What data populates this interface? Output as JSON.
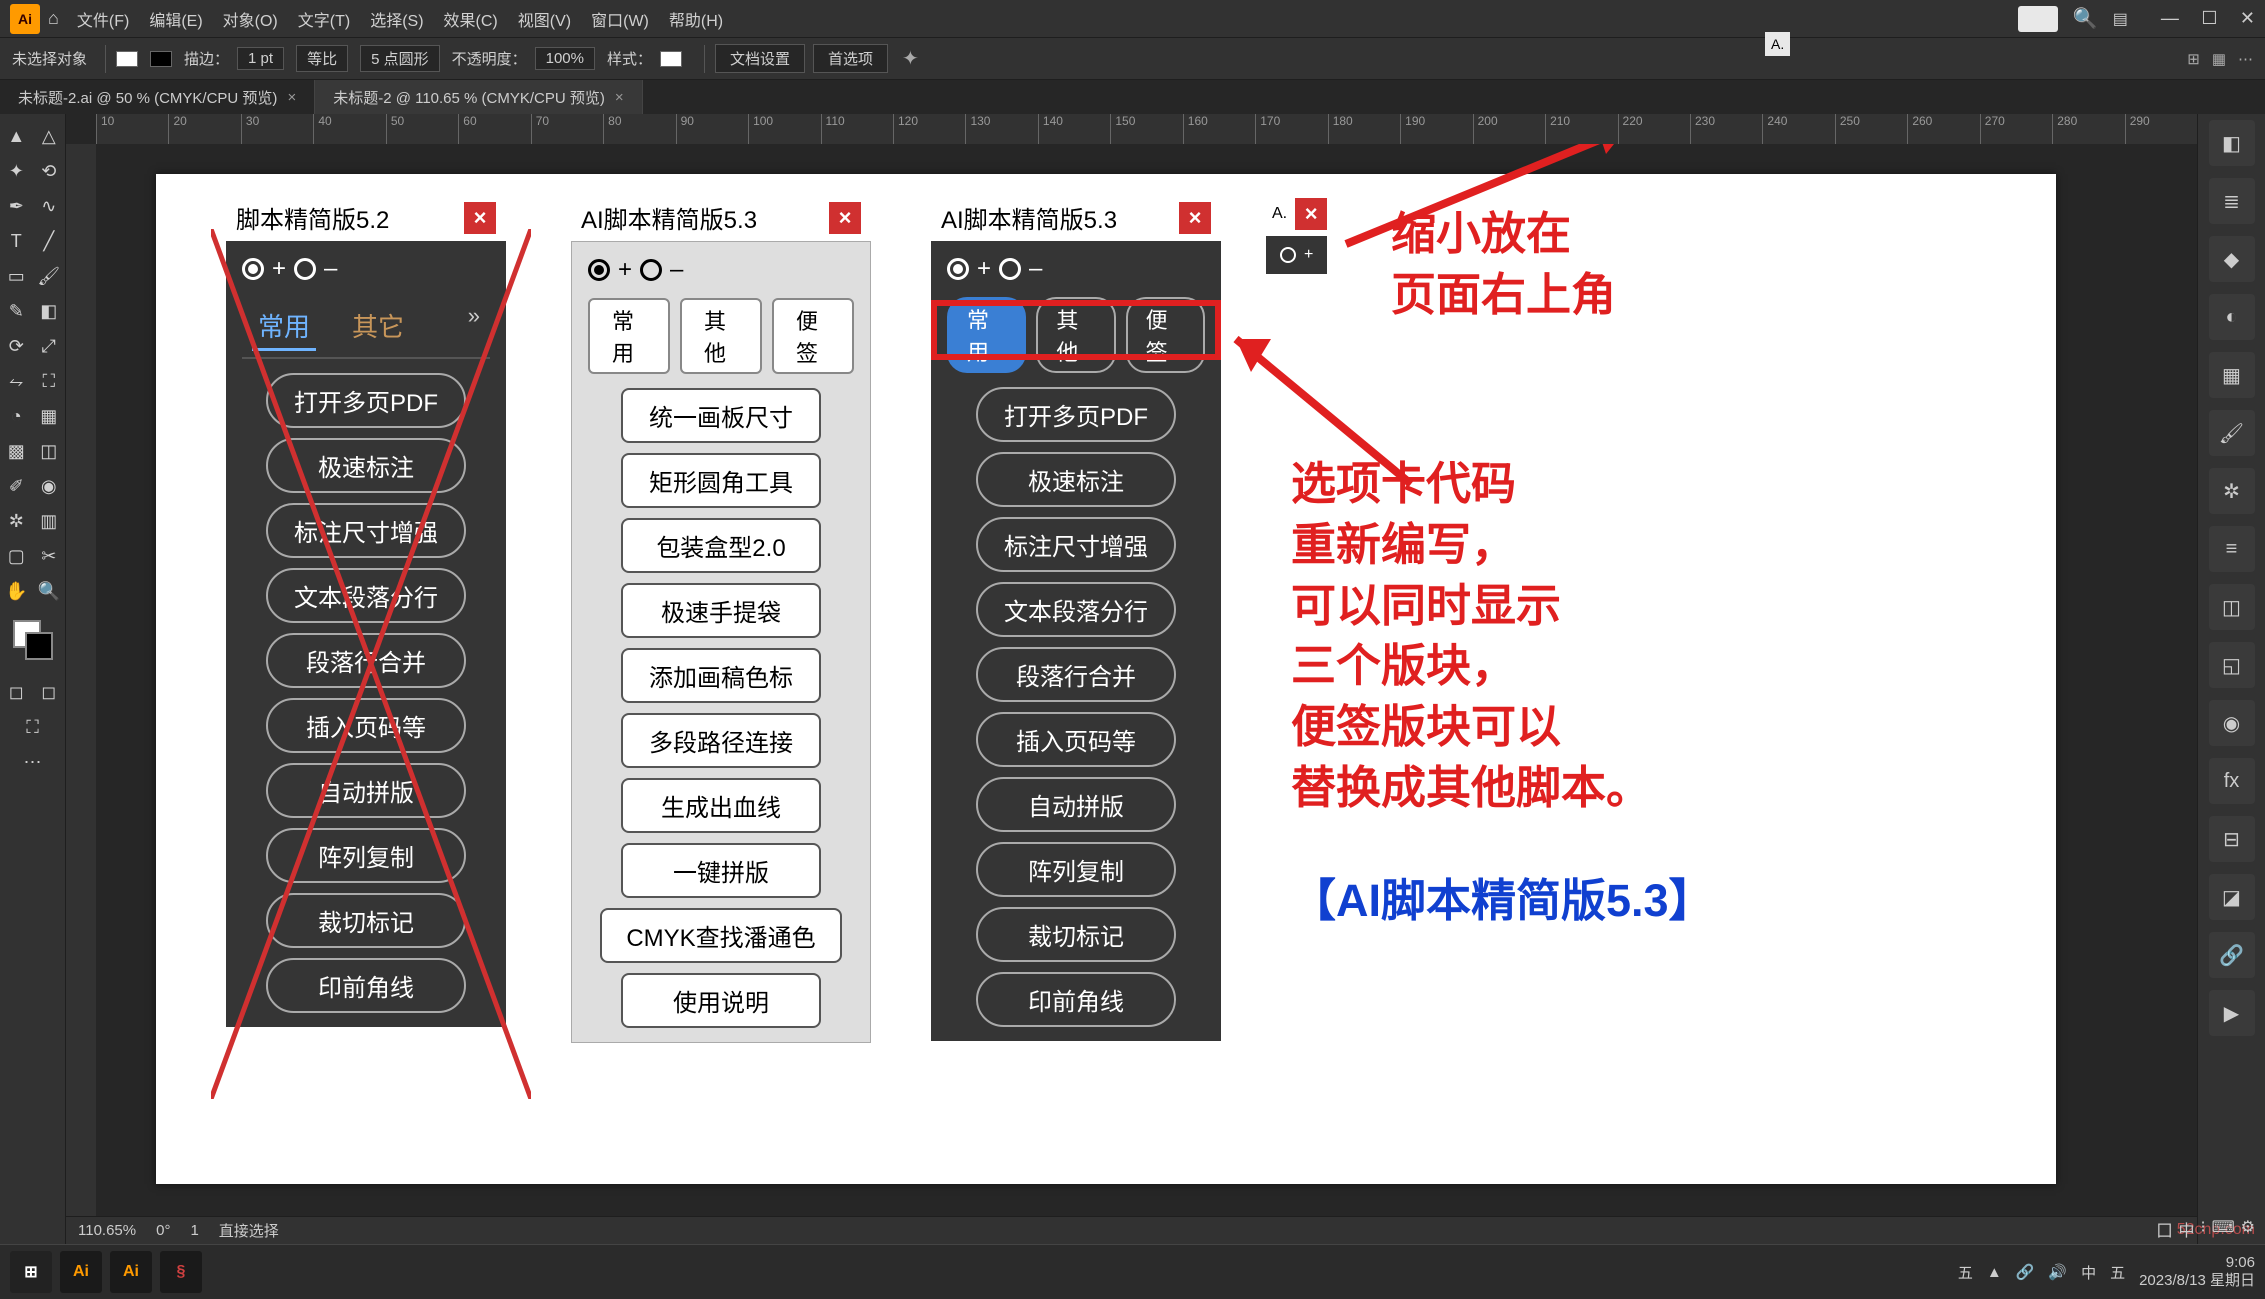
{
  "menubar": {
    "items": [
      "文件(F)",
      "编辑(E)",
      "对象(O)",
      "文字(T)",
      "选择(S)",
      "效果(C)",
      "视图(V)",
      "窗口(W)",
      "帮助(H)"
    ],
    "search_placeholder": "A..."
  },
  "optionsbar": {
    "no_selection": "未选择对象",
    "stroke_label": "描边：",
    "stroke_value": "1 pt",
    "uniform": "等比",
    "brush_label": "5 点圆形",
    "opacity_label": "不透明度：",
    "opacity_value": "100%",
    "style_label": "样式：",
    "doc_setup": "文档设置",
    "prefs": "首选项"
  },
  "tabs": {
    "t1": "未标题-2.ai @ 50 % (CMYK/CPU 预览)",
    "t2": "未标题-2 @ 110.65 % (CMYK/CPU 预览)"
  },
  "ruler_marks": [
    "10",
    "20",
    "30",
    "40",
    "50",
    "60",
    "70",
    "80",
    "90",
    "100",
    "110",
    "120",
    "130",
    "140",
    "150",
    "160",
    "170",
    "180",
    "190",
    "200",
    "210",
    "220",
    "230",
    "240",
    "250",
    "260",
    "270",
    "280",
    "290"
  ],
  "panel52": {
    "title": "脚本精简版5.2",
    "tabs": {
      "a": "常用",
      "b": "其它"
    },
    "buttons": [
      "打开多页PDF",
      "极速标注",
      "标注尺寸增强",
      "文本段落分行",
      "段落行合并",
      "插入页码等",
      "自动拼版",
      "阵列复制",
      "裁切标记",
      "印前角线"
    ]
  },
  "panel53light": {
    "title": "AI脚本精简版5.3",
    "tabs": {
      "a": "常用",
      "b": "其他",
      "c": "便签"
    },
    "buttons": [
      "统一画板尺寸",
      "矩形圆角工具",
      "包装盒型2.0",
      "极速手提袋",
      "添加画稿色标",
      "多段路径连接",
      "生成出血线",
      "一键拼版",
      "CMYK查找潘通色",
      "使用说明"
    ]
  },
  "panel53dark": {
    "title": "AI脚本精简版5.3",
    "tabs": {
      "a": "常用",
      "b": "其他",
      "c": "便签"
    },
    "buttons": [
      "打开多页PDF",
      "极速标注",
      "标注尺寸增强",
      "文本段落分行",
      "段落行合并",
      "插入页码等",
      "自动拼版",
      "阵列复制",
      "裁切标记",
      "印前角线"
    ]
  },
  "mini": {
    "title": "A."
  },
  "annotations": {
    "topright": "缩小放在\n页面右上角",
    "mid": "选项卡代码\n重新编写，\n可以同时显示\n三个版块，\n便签版块可以\n替换成其他脚本。",
    "blue": "【AI脚本精简版5.3】"
  },
  "statusbar": {
    "zoom": "110.65%",
    "rotate": "0°",
    "artboard": "1",
    "tool": "直接选择"
  },
  "taskbar": {
    "time": "9:06",
    "date": "2023/8/13 星期日"
  },
  "watermark": "52cnp.com"
}
